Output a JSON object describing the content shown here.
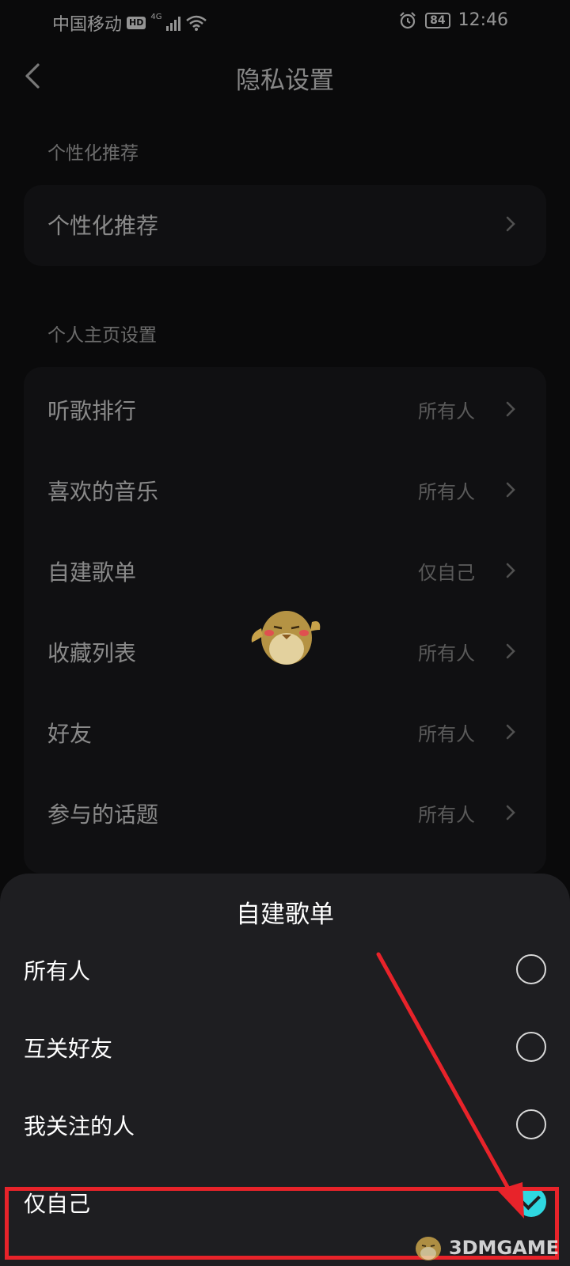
{
  "status_bar": {
    "carrier": "中国移动",
    "hd": "HD",
    "network": "4G",
    "battery": "84",
    "time": "12:46"
  },
  "header": {
    "title": "隐私设置",
    "back_icon": "chevron-left-icon"
  },
  "sections": [
    {
      "label": "个性化推荐",
      "rows": [
        {
          "label": "个性化推荐",
          "value": ""
        }
      ]
    },
    {
      "label": "个人主页设置",
      "rows": [
        {
          "label": "听歌排行",
          "value": "所有人"
        },
        {
          "label": "喜欢的音乐",
          "value": "所有人"
        },
        {
          "label": "自建歌单",
          "value": "仅自己"
        },
        {
          "label": "收藏列表",
          "value": "所有人"
        },
        {
          "label": "好友",
          "value": "所有人"
        },
        {
          "label": "参与的话题",
          "value": "所有人"
        }
      ]
    }
  ],
  "sheet": {
    "title": "自建歌单",
    "options": [
      {
        "label": "所有人",
        "selected": false
      },
      {
        "label": "互关好友",
        "selected": false
      },
      {
        "label": "我关注的人",
        "selected": false
      },
      {
        "label": "仅自己",
        "selected": true
      }
    ]
  },
  "annotation": {
    "color": "#e8232a"
  },
  "accent_color": "#2fd7e0",
  "watermark": {
    "text": "3DMGAME"
  }
}
